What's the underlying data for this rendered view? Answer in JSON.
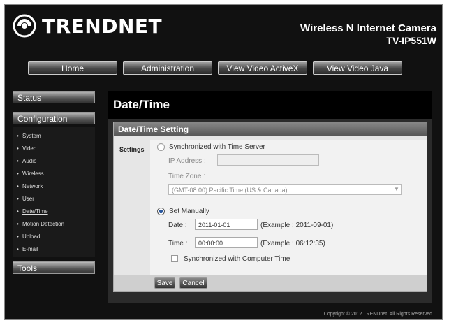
{
  "header": {
    "logo_text": "TRENDNET",
    "product_name": "Wireless N Internet Camera",
    "product_model": "TV-IP551W"
  },
  "nav": {
    "home": "Home",
    "administration": "Administration",
    "view_video_activex": "View Video   ActiveX",
    "view_video_java": "View Video     Java"
  },
  "sidebar": {
    "status": "Status",
    "configuration": "Configuration",
    "items": [
      "System",
      "Video",
      "Audio",
      "Wireless",
      "Network",
      "User",
      "Date/Time",
      "Motion Detection",
      "Upload",
      "E-mail"
    ],
    "tools": "Tools"
  },
  "page": {
    "title": "Date/Time",
    "section_title": "Date/Time Setting",
    "settings_label": "Settings",
    "sync_server_label": "Synchronized with Time Server",
    "ip_address_label": "IP Address  :",
    "ip_address_value": "",
    "timezone_label": "Time Zone  :",
    "timezone_value": "(GMT-08:00) Pacific Time (US & Canada)",
    "set_manually_label": "Set Manually",
    "date_label": "Date  :",
    "date_value": "2011-01-01",
    "date_example": "(Example : 2011-09-01)",
    "time_label": "Time  :",
    "time_value": "00:00:00",
    "time_example": "(Example : 06:12:35)",
    "sync_computer_label": "Synchronized with Computer Time",
    "save_button": "Save",
    "cancel_button": "Cancel"
  },
  "footer": {
    "copyright": "Copyright © 2012 TRENDnet.  All Rights Reserved."
  }
}
